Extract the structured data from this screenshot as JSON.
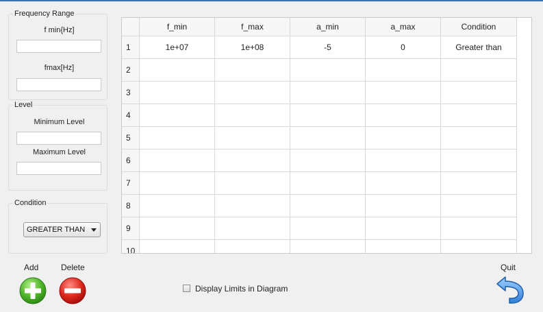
{
  "frequency": {
    "group_title": "Frequency Range",
    "fmin_label": "f min{Hz]",
    "fmin_value": "",
    "fmax_label": "fmax[Hz]",
    "fmax_value": ""
  },
  "level": {
    "group_title": "Level",
    "min_label": "Minimum Level",
    "min_value": "",
    "max_label": "Maximum Level",
    "max_value": ""
  },
  "condition": {
    "group_title": "Condition",
    "selected": "GREATER THAN"
  },
  "table": {
    "columns": [
      "f_min",
      "f_max",
      "a_min",
      "a_max",
      "Condition"
    ],
    "row_numbers": [
      "1",
      "2",
      "3",
      "4",
      "5",
      "6",
      "7",
      "8",
      "9",
      "10"
    ],
    "rows": [
      [
        "1e+07",
        "1e+08",
        "-5",
        "0",
        "Greater than"
      ],
      [
        "",
        "",
        "",
        "",
        ""
      ],
      [
        "",
        "",
        "",
        "",
        ""
      ],
      [
        "",
        "",
        "",
        "",
        ""
      ],
      [
        "",
        "",
        "",
        "",
        ""
      ],
      [
        "",
        "",
        "",
        "",
        ""
      ],
      [
        "",
        "",
        "",
        "",
        ""
      ],
      [
        "",
        "",
        "",
        "",
        ""
      ],
      [
        "",
        "",
        "",
        "",
        ""
      ],
      [
        "",
        "",
        "",
        "",
        ""
      ]
    ]
  },
  "actions": {
    "add_label": "Add",
    "delete_label": "Delete",
    "quit_label": "Quit",
    "display_limits_label": "Display Limits in Diagram",
    "display_limits_checked": false
  },
  "icons": {
    "add": "plus-circle-icon",
    "delete": "minus-circle-icon",
    "quit": "back-arrow-icon"
  }
}
